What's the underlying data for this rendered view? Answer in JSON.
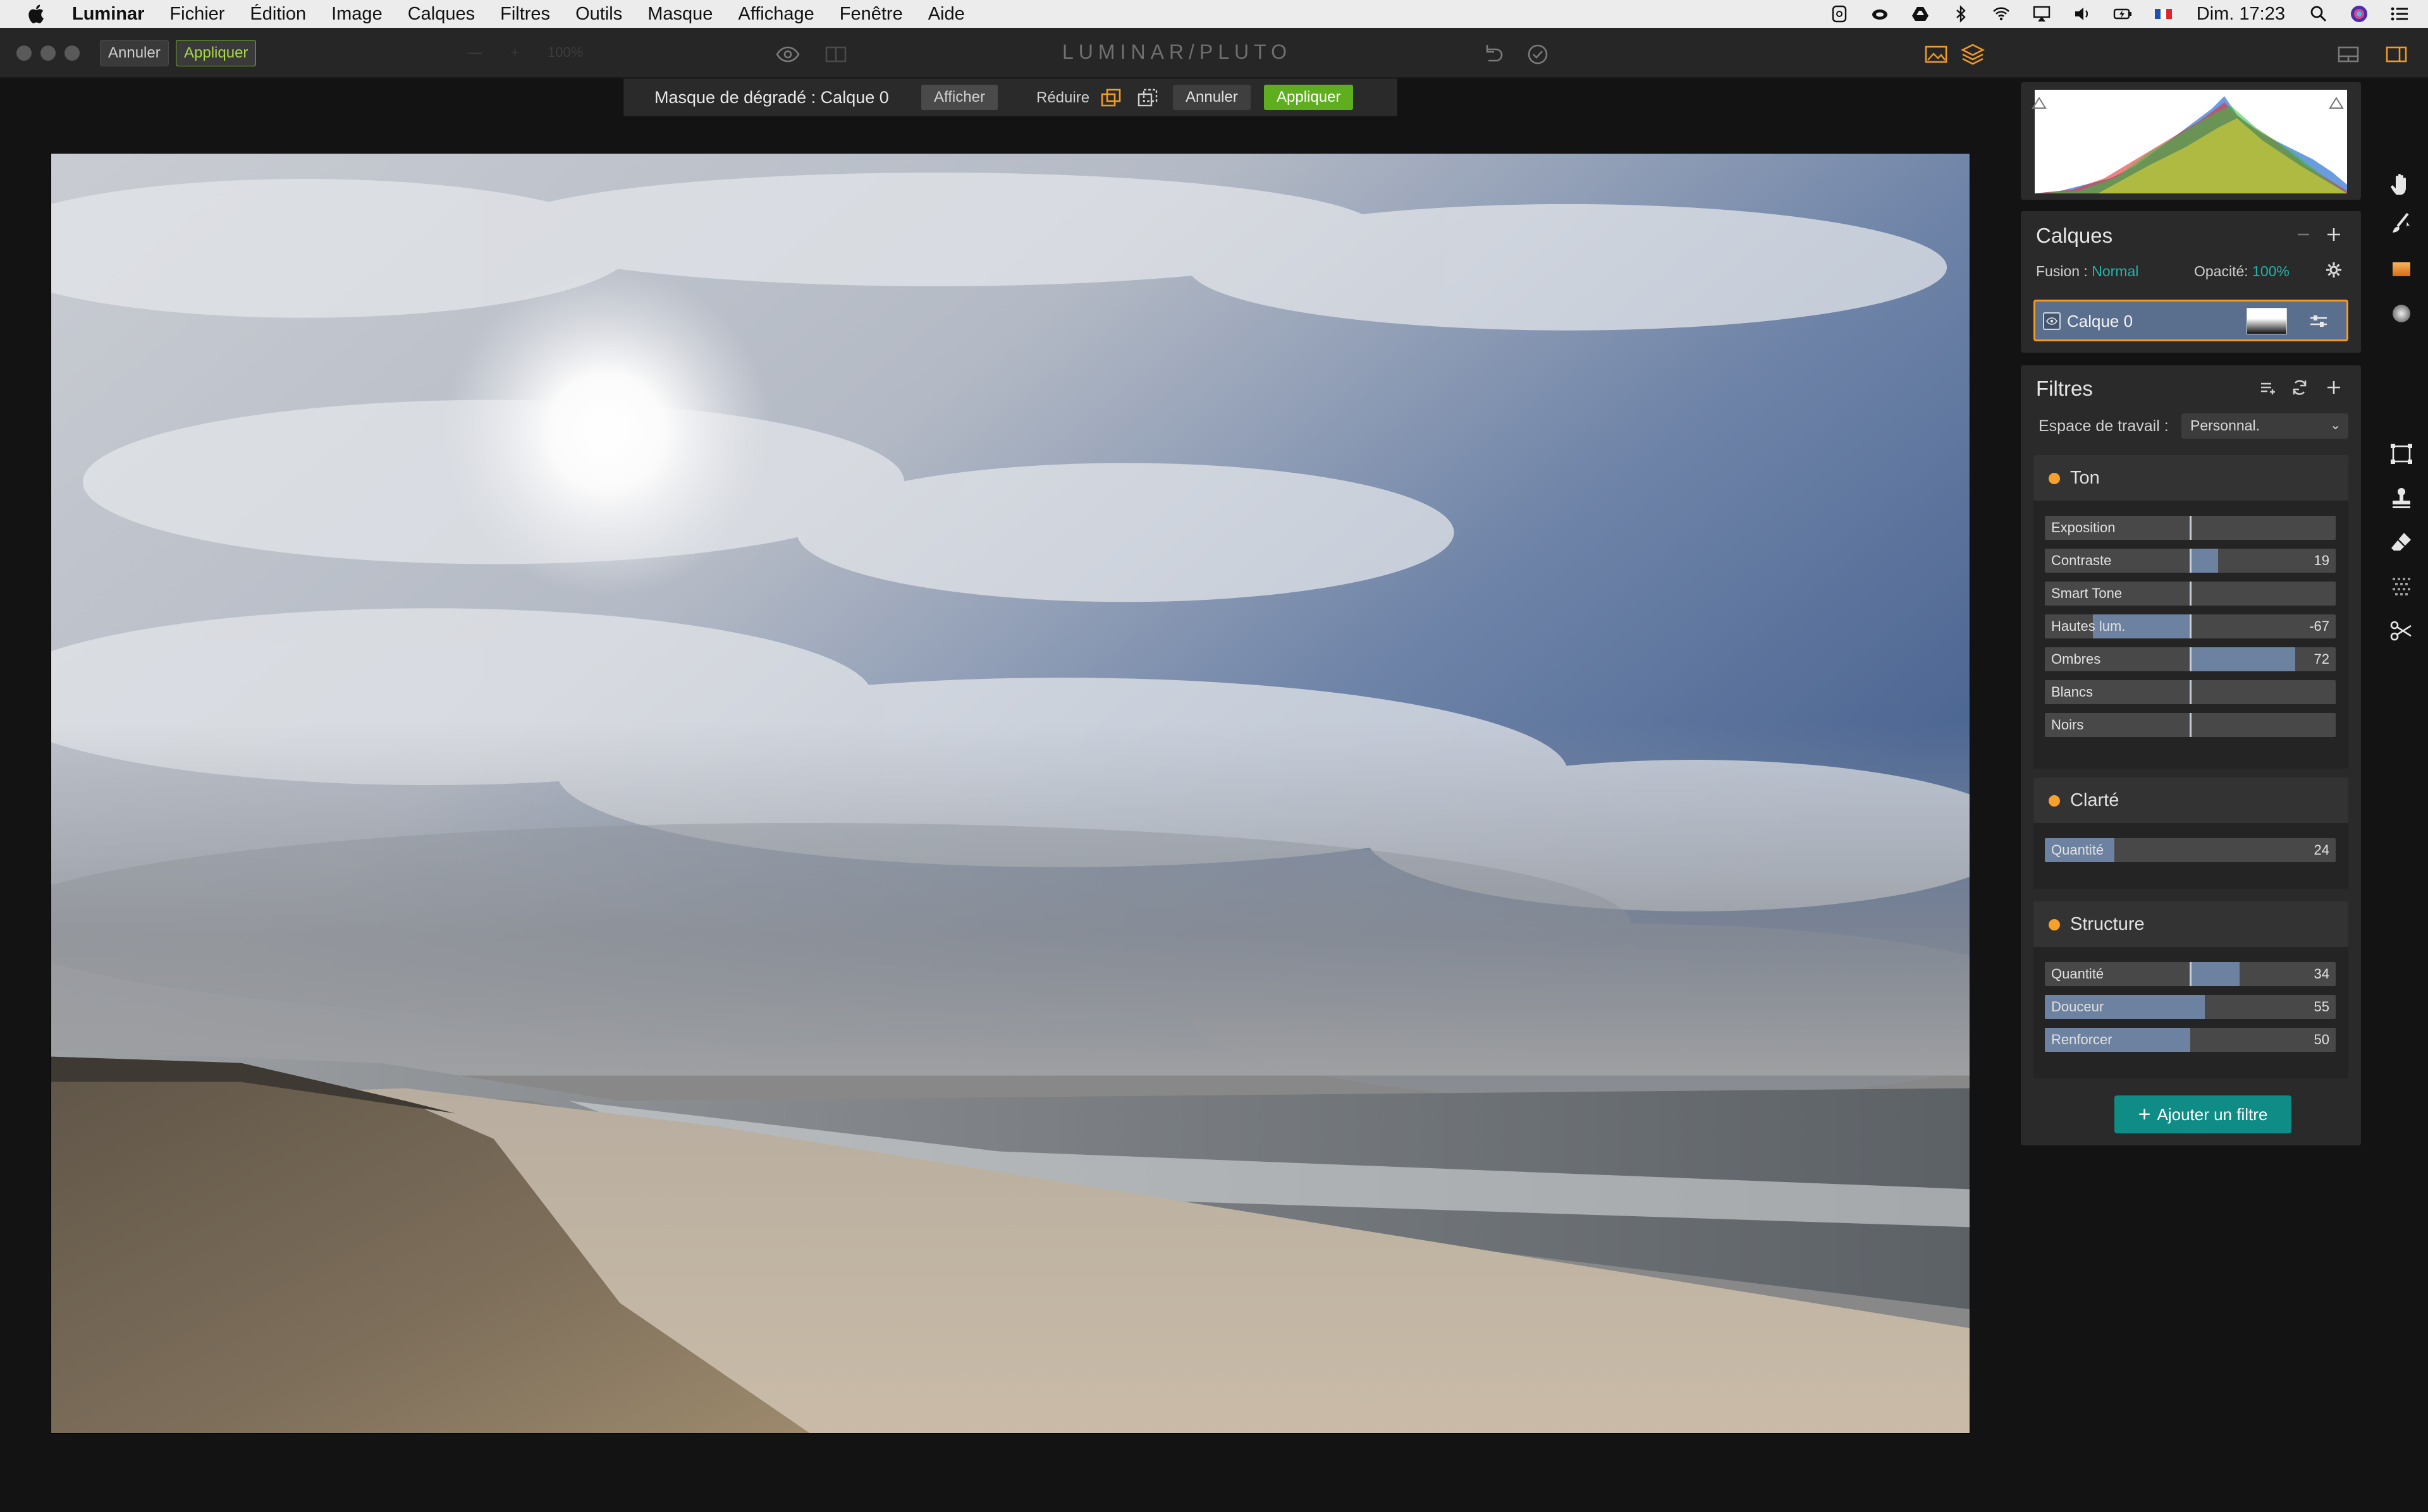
{
  "menubar": {
    "items": [
      "Luminar",
      "Fichier",
      "Édition",
      "Image",
      "Calques",
      "Filtres",
      "Outils",
      "Masque",
      "Affichage",
      "Fenêtre",
      "Aide"
    ],
    "clock": "Dim. 17:23"
  },
  "toolbar": {
    "undo_label": "Annuler",
    "apply_label": "Appliquer",
    "zoom": "100%",
    "logo": "LUMINAR/PLUTO"
  },
  "maskbar": {
    "title": "Masque de dégradé : Calque 0",
    "show_label": "Afficher",
    "reduce_label": "Réduire",
    "cancel_label": "Annuler",
    "apply_label": "Appliquer"
  },
  "layers": {
    "title": "Calques",
    "fusion_label": "Fusion :",
    "fusion_value": "Normal",
    "opacity_label": "Opacité:",
    "opacity_value": "100%",
    "layer_name": "Calque 0"
  },
  "filters": {
    "title": "Filtres",
    "workspace_label": "Espace de travail :",
    "workspace_value": "Personnal.",
    "add_label": "Ajouter un filtre",
    "groups": [
      {
        "name": "Ton",
        "sliders": [
          {
            "label": "Exposition",
            "value": 0,
            "display": ""
          },
          {
            "label": "Contraste",
            "value": 19,
            "display": "19"
          },
          {
            "label": "Smart Tone",
            "value": 0,
            "display": ""
          },
          {
            "label": "Hautes lum.",
            "value": -67,
            "display": "-67"
          },
          {
            "label": "Ombres",
            "value": 72,
            "display": "72"
          },
          {
            "label": "Blancs",
            "value": 0,
            "display": ""
          },
          {
            "label": "Noirs",
            "value": 0,
            "display": ""
          }
        ]
      },
      {
        "name": "Clarté",
        "sliders": [
          {
            "label": "Quantité",
            "value": 24,
            "display": "24",
            "mode": "left"
          }
        ]
      },
      {
        "name": "Structure",
        "sliders": [
          {
            "label": "Quantité",
            "value": 34,
            "display": "34"
          },
          {
            "label": "Douceur",
            "value": 55,
            "display": "55",
            "mode": "left"
          },
          {
            "label": "Renforcer",
            "value": 50,
            "display": "50",
            "mode": "left"
          }
        ]
      }
    ]
  },
  "colors": {
    "accent_orange": "#f29a22",
    "accent_teal": "#22b3aa",
    "apply_green": "#5fae1f",
    "slider_fill": "#6d82a1"
  },
  "icons": {
    "toolstrip": [
      "hand-icon",
      "brush-icon",
      "gradient-icon",
      "radial-icon",
      "crop-icon",
      "stamp-icon",
      "eraser-icon",
      "noise-icon",
      "scissors-icon"
    ]
  }
}
